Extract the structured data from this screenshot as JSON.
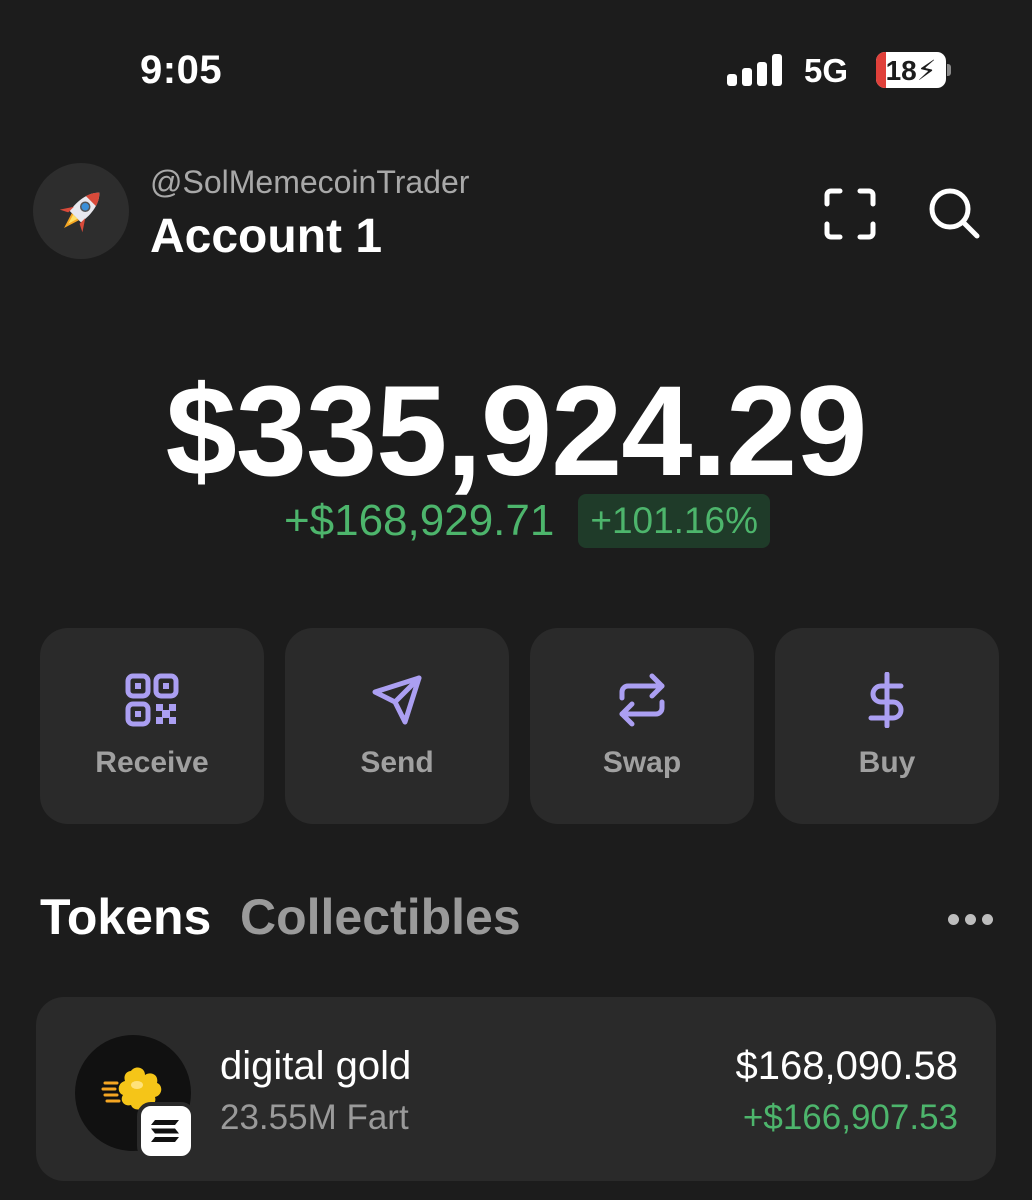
{
  "status_bar": {
    "time": "9:05",
    "network": "5G",
    "battery": "18"
  },
  "account": {
    "handle": "@SolMemecoinTrader",
    "name": "Account 1",
    "avatar_icon": "rocket-icon"
  },
  "balance": {
    "total": "$335,924.29",
    "change_amount": "+$168,929.71",
    "change_percent": "+101.16%"
  },
  "actions": [
    {
      "label": "Receive",
      "icon": "qr-code-icon"
    },
    {
      "label": "Send",
      "icon": "send-icon"
    },
    {
      "label": "Swap",
      "icon": "swap-icon"
    },
    {
      "label": "Buy",
      "icon": "dollar-icon"
    }
  ],
  "tabs": {
    "tokens": "Tokens",
    "collectibles": "Collectibles",
    "active": "Tokens"
  },
  "tokens": [
    {
      "name": "digital gold",
      "amount": "23.55M Fart",
      "value": "$168,090.58",
      "change": "+$166,907.53",
      "icon": "fartcoin-icon",
      "chain_icon": "solana-icon"
    }
  ],
  "colors": {
    "background": "#1c1c1c",
    "card": "#2a2a2a",
    "accent": "#ab9ff2",
    "positive": "#4db56c"
  }
}
